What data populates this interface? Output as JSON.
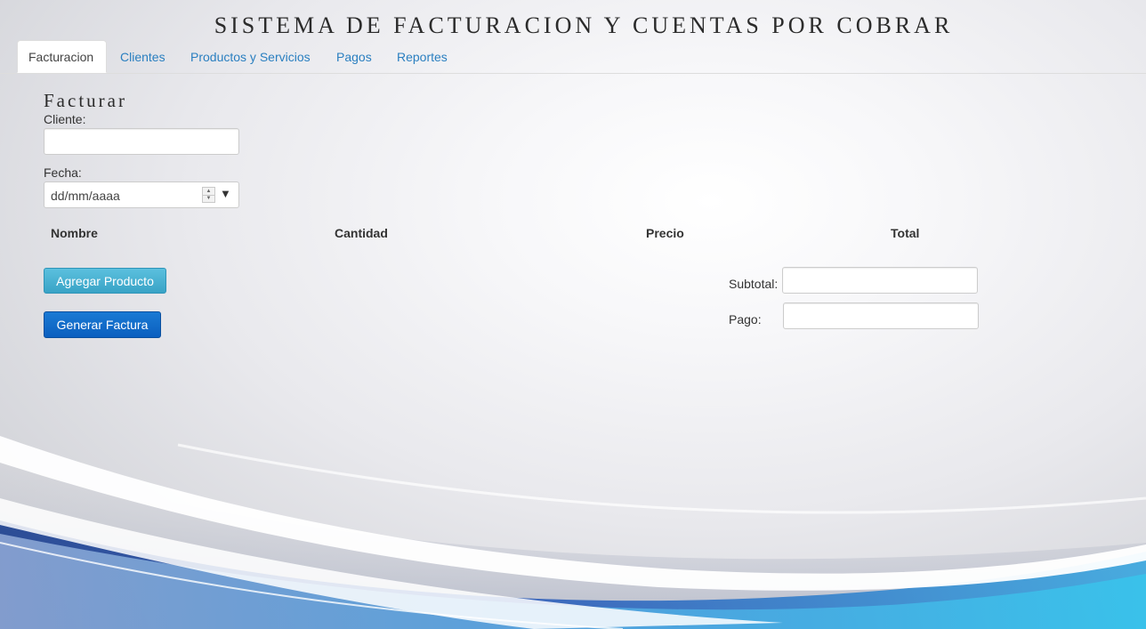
{
  "app": {
    "title": "SISTEMA DE FACTURACION Y CUENTAS POR COBRAR"
  },
  "tabs": [
    {
      "label": "Facturacion",
      "active": true
    },
    {
      "label": "Clientes",
      "active": false
    },
    {
      "label": "Productos y Servicios",
      "active": false
    },
    {
      "label": "Pagos",
      "active": false
    },
    {
      "label": "Reportes",
      "active": false
    }
  ],
  "form": {
    "title": "Facturar",
    "cliente_label": "Cliente:",
    "cliente_value": "",
    "fecha_label": "Fecha:",
    "fecha_placeholder": "dd/mm/aaaa"
  },
  "table": {
    "headers": [
      "Nombre",
      "Cantidad",
      "Precio",
      "Total"
    ]
  },
  "buttons": {
    "add_product": "Agregar Producto",
    "generate_invoice": "Generar Factura"
  },
  "totals": {
    "subtotal_label": "Subtotal:",
    "subtotal_value": "",
    "pago_label": "Pago:",
    "pago_value": ""
  },
  "colors": {
    "link": "#2a7fc0",
    "info_button": "#5bc0de",
    "primary_button": "#0b5fbf"
  }
}
